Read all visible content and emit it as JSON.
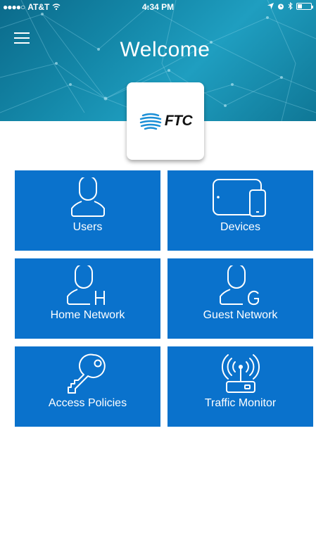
{
  "status_bar": {
    "carrier": "AT&T",
    "time": "4:34 PM"
  },
  "header": {
    "title": "Welcome",
    "logo_text": "FTC"
  },
  "tiles": [
    {
      "label": "Users",
      "icon": "user-icon"
    },
    {
      "label": "Devices",
      "icon": "devices-icon"
    },
    {
      "label": "Home Network",
      "icon": "home-network-user-icon"
    },
    {
      "label": "Guest Network",
      "icon": "guest-network-user-icon"
    },
    {
      "label": "Access Policies",
      "icon": "key-icon"
    },
    {
      "label": "Traffic Monitor",
      "icon": "router-icon"
    }
  ],
  "colors": {
    "tile": "#0a72cc",
    "header": "#1488a9"
  }
}
